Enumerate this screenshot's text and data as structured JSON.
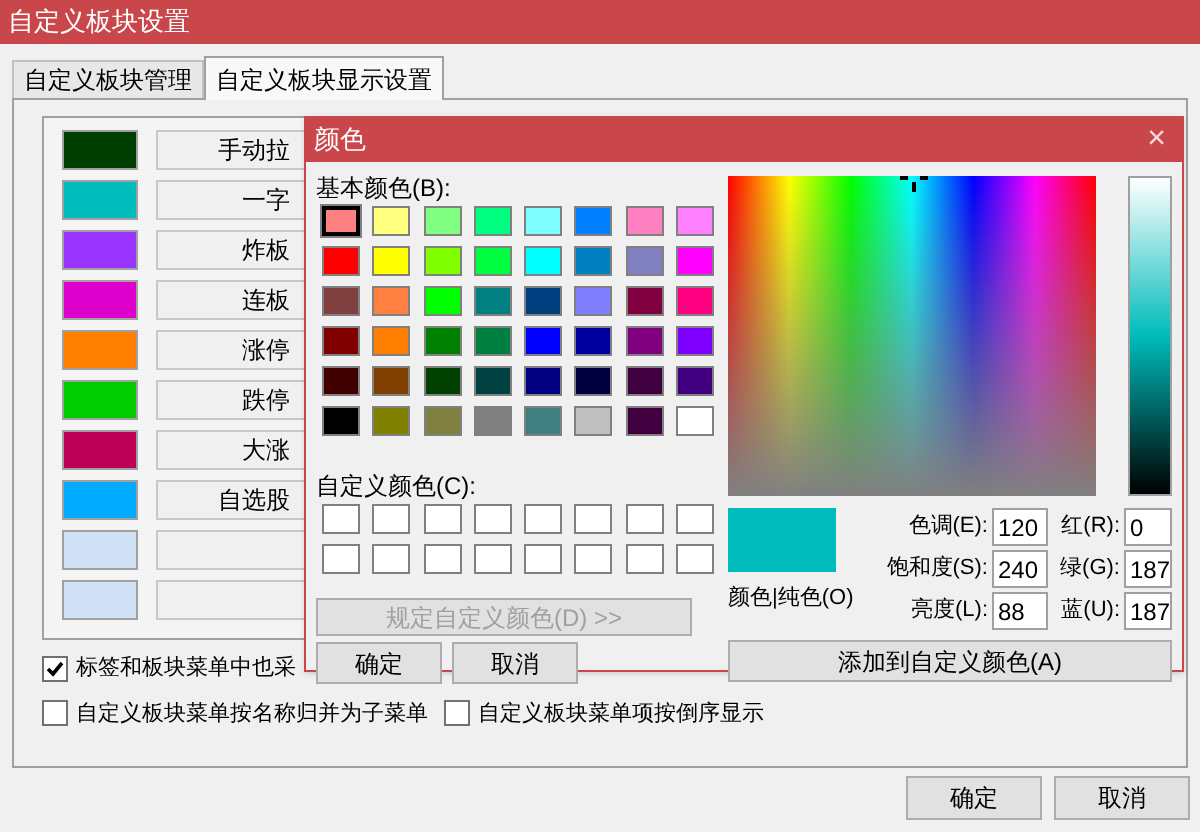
{
  "window": {
    "title": "自定义板块设置"
  },
  "tabs": [
    {
      "label": "自定义板块管理",
      "selected": false
    },
    {
      "label": "自定义板块显示设置",
      "selected": true
    }
  ],
  "block_colors": [
    {
      "color": "#003f00",
      "label": "手动拉"
    },
    {
      "color": "#00bbbb",
      "label": "一字"
    },
    {
      "color": "#9933ff",
      "label": "炸板"
    },
    {
      "color": "#dd00cc",
      "label": "连板"
    },
    {
      "color": "#ff8000",
      "label": "涨停"
    },
    {
      "color": "#00cc00",
      "label": "跌停"
    },
    {
      "color": "#bb0055",
      "label": "大涨"
    },
    {
      "color": "#00aaff",
      "label": "自选股"
    },
    {
      "color": "#cfe0f5"
    },
    {
      "color": "#cfe0f5"
    }
  ],
  "options": [
    {
      "label": "标签和板块菜单中也采",
      "checked": true
    },
    {
      "label": "自定义板块菜单按名称归并为子菜单",
      "checked": false
    },
    {
      "label": "自定义板块菜单项按倒序显示",
      "checked": false
    }
  ],
  "buttons": [
    {
      "label": "确定"
    },
    {
      "label": "取消"
    }
  ],
  "color_dialog": {
    "title": "颜色",
    "close": "×",
    "basic_colors_label": "基本颜色(B):",
    "basic_colors": [
      {
        "color": "#ff8080",
        "selected": true
      },
      {
        "color": "#ffff80",
        "selected": false
      },
      {
        "color": "#80ff80",
        "selected": false
      },
      {
        "color": "#00ff80",
        "selected": false
      },
      {
        "color": "#80ffff",
        "selected": false
      },
      {
        "color": "#0080ff",
        "selected": false
      },
      {
        "color": "#ff80c0",
        "selected": false
      },
      {
        "color": "#ff80ff",
        "selected": false
      },
      {
        "color": "#ff0000",
        "selected": false
      },
      {
        "color": "#ffff00",
        "selected": false
      },
      {
        "color": "#80ff00",
        "selected": false
      },
      {
        "color": "#00ff40",
        "selected": false
      },
      {
        "color": "#00ffff",
        "selected": false
      },
      {
        "color": "#0080c0",
        "selected": false
      },
      {
        "color": "#8080c0",
        "selected": false
      },
      {
        "color": "#ff00ff",
        "selected": false
      },
      {
        "color": "#804040",
        "selected": false
      },
      {
        "color": "#ff8040",
        "selected": false
      },
      {
        "color": "#00ff00",
        "selected": false
      },
      {
        "color": "#008080",
        "selected": false
      },
      {
        "color": "#004080",
        "selected": false
      },
      {
        "color": "#8080ff",
        "selected": false
      },
      {
        "color": "#800040",
        "selected": false
      },
      {
        "color": "#ff0080",
        "selected": false
      },
      {
        "color": "#800000",
        "selected": false
      },
      {
        "color": "#ff8000",
        "selected": false
      },
      {
        "color": "#008000",
        "selected": false
      },
      {
        "color": "#008040",
        "selected": false
      },
      {
        "color": "#0000ff",
        "selected": false
      },
      {
        "color": "#0000a0",
        "selected": false
      },
      {
        "color": "#800080",
        "selected": false
      },
      {
        "color": "#8000ff",
        "selected": false
      },
      {
        "color": "#400000",
        "selected": false
      },
      {
        "color": "#804000",
        "selected": false
      },
      {
        "color": "#004000",
        "selected": false
      },
      {
        "color": "#004040",
        "selected": false
      },
      {
        "color": "#000080",
        "selected": false
      },
      {
        "color": "#000040",
        "selected": false
      },
      {
        "color": "#400040",
        "selected": false
      },
      {
        "color": "#400080",
        "selected": false
      },
      {
        "color": "#000000",
        "selected": false
      },
      {
        "color": "#808000",
        "selected": false
      },
      {
        "color": "#808040",
        "selected": false
      },
      {
        "color": "#808080",
        "selected": false
      },
      {
        "color": "#408080",
        "selected": false
      },
      {
        "color": "#c0c0c0",
        "selected": false
      },
      {
        "color": "#400040",
        "selected": false
      },
      {
        "color": "#ffffff",
        "selected": false
      }
    ],
    "custom_colors_label": "自定义颜色(C):",
    "define_custom_button": {
      "label": "规定自定义颜色(D) >>",
      "disabled": true
    },
    "ok_button": "确定",
    "cancel_button": "取消",
    "preview": {
      "color": "#00bbbb",
      "label": "颜色|纯色(O)"
    },
    "fields": [
      {
        "label": "色调(E):",
        "value": "120"
      },
      {
        "label": "红(R):",
        "value": "0"
      },
      {
        "label": "饱和度(S):",
        "value": "240"
      },
      {
        "label": "绿(G):",
        "value": "187"
      },
      {
        "label": "亮度(L):",
        "value": "88"
      },
      {
        "label": "蓝(U):",
        "value": "187"
      }
    ],
    "add_button": "添加到自定义颜色(A)"
  }
}
